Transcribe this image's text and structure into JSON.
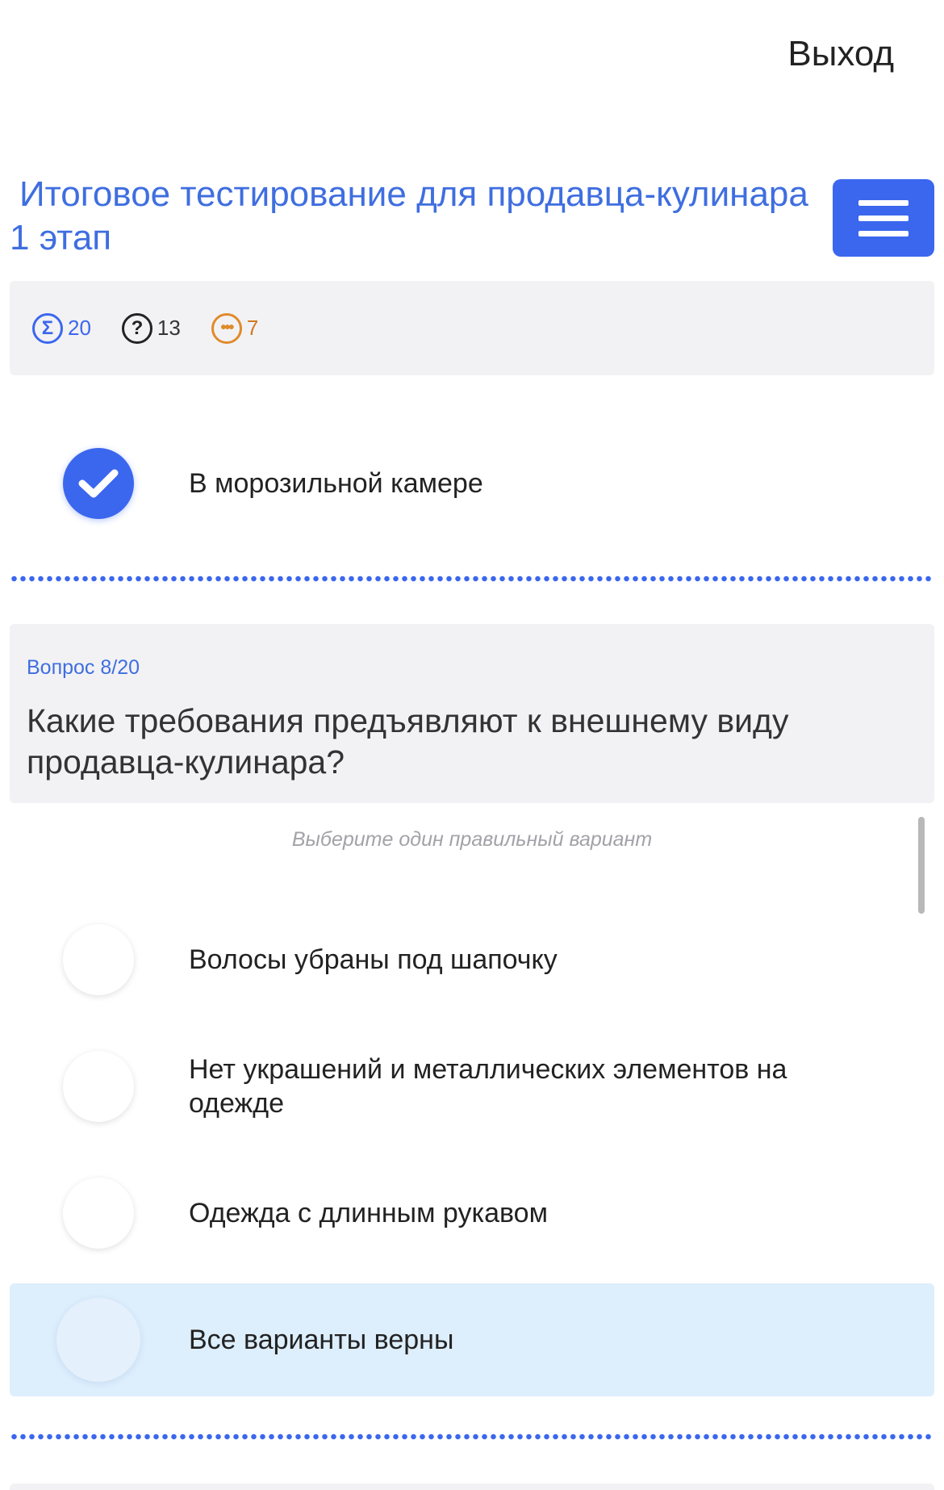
{
  "header": {
    "exit_label": "Выход",
    "title_line1": "Итоговое тестирование для продавца-кулинара",
    "title_line2": "1 этап",
    "menu_icon": "hamburger-icon"
  },
  "stats": {
    "total": "20",
    "answered": "13",
    "remaining": "7",
    "total_icon": "sigma-icon",
    "answered_icon": "question-icon",
    "remaining_icon": "ellipsis-icon"
  },
  "previous_question": {
    "selected_option": "В морозильной камере"
  },
  "question": {
    "number_label": "Вопрос 8/20",
    "text": "Какие требования предъявляют к внешнему виду продавца-кулинара?",
    "hint": "Выберите один правильный вариант",
    "options": [
      "Волосы убраны под шапочку",
      "Нет украшений и металлических элементов на одежде",
      "Одежда с длинным рукавом",
      "Все варианты верны"
    ]
  },
  "colors": {
    "accent": "#3b67ee",
    "title": "#3f6ee0",
    "remaining": "#e08a2a",
    "highlight": "#ddeefc"
  }
}
